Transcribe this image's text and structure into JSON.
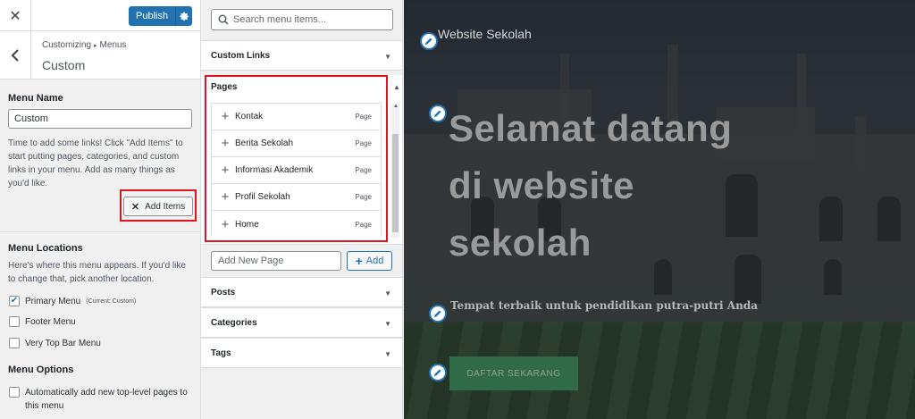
{
  "topbar": {
    "close_icon": "close-icon",
    "publish_label": "Publish",
    "settings_icon": "gear-icon"
  },
  "header": {
    "breadcrumb_root": "Customizing",
    "breadcrumb_leaf": "Menus",
    "title": "Custom"
  },
  "menu_name": {
    "label": "Menu Name",
    "value": "Custom",
    "help": "Time to add some links! Click \"Add Items\" to start putting pages, categories, and custom links in your menu. Add as many things as you'd like.",
    "add_items_label": "Add Items"
  },
  "menu_locations": {
    "label": "Menu Locations",
    "help": "Here's where this menu appears. If you'd like to change that, pick another location.",
    "options": [
      {
        "label": "Primary Menu",
        "note": "(Current: Custom)",
        "checked": true
      },
      {
        "label": "Footer Menu",
        "note": "",
        "checked": false
      },
      {
        "label": "Very Top Bar Menu",
        "note": "",
        "checked": false
      }
    ]
  },
  "menu_options": {
    "label": "Menu Options",
    "auto_add": "Automatically add new top-level pages to this menu",
    "auto_add_checked": false
  },
  "items_panel": {
    "search_placeholder": "Search menu items...",
    "custom_links": "Custom Links",
    "pages_title": "Pages",
    "pages": [
      {
        "title": "Kontak",
        "type": "Page"
      },
      {
        "title": "Berita Sekolah",
        "type": "Page"
      },
      {
        "title": "Informasi Akademik",
        "type": "Page"
      },
      {
        "title": "Profil Sekolah",
        "type": "Page"
      },
      {
        "title": "Home",
        "type": "Page"
      }
    ],
    "new_page_placeholder": "Add New Page",
    "add_label": "Add",
    "posts": "Posts",
    "categories": "Categories",
    "tags": "Tags"
  },
  "preview": {
    "site_title": "Website Sekolah",
    "hero_line1": "Selamat datang",
    "hero_line2": "di website",
    "hero_line3": "sekolah",
    "tagline": "Tempat terbaik untuk pendidikan putra-putri Anda",
    "cta_label": "DAFTAR SEKARANG"
  },
  "colors": {
    "accent": "#2271b1",
    "highlight": "#e0141e",
    "cta": "#2f6b46"
  }
}
